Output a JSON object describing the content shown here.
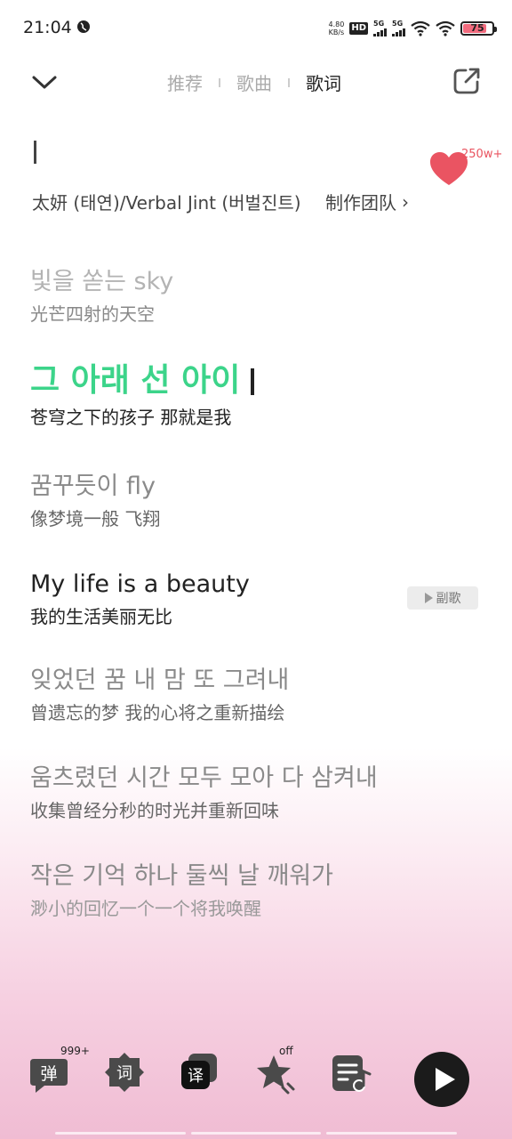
{
  "status_bar": {
    "time": "21:04",
    "net_speed_value": "4.80",
    "net_speed_unit": "KB/s",
    "hd_label": "HD",
    "hd_sub": "1",
    "hd_sub2": "2",
    "sig1": "5G",
    "sig2": "5G",
    "battery": "75"
  },
  "header": {
    "tabs": [
      {
        "label": "推荐"
      },
      {
        "label": "歌曲"
      },
      {
        "label": "歌词"
      }
    ],
    "active_tab": "歌词"
  },
  "song": {
    "like_count": "250w+",
    "artist": "太妍 (태연)/Verbal Jint (버벌진트)",
    "credits_label": "制作团队"
  },
  "lyrics": [
    {
      "orig": "빛을 쏟는 sky",
      "trans": "光芒四射的天空"
    },
    {
      "orig": "그 아래 선 아이",
      "trans": "苍穹之下的孩子 那就是我"
    },
    {
      "orig": "꿈꾸듯이 fly",
      "trans": "像梦境一般 飞翔"
    },
    {
      "orig": "My life is a beauty",
      "trans": "我的生活美丽无比"
    },
    {
      "orig": "잊었던 꿈 내 맘 또 그려내",
      "trans": "曾遗忘的梦 我的心将之重新描绘"
    },
    {
      "orig": "움츠렸던 시간 모두 모아 다 삼켜내",
      "trans": "收集曾经分秒的时光并重新回味"
    },
    {
      "orig": "작은 기억 하나 둘씩 날 깨워가",
      "trans": "渺小的回忆一个一个将我唤醒"
    }
  ],
  "chorus_label": "副歌",
  "toolbar": {
    "danmaku_label": "弹",
    "danmaku_badge": "999+",
    "lyric_label": "词",
    "translate_label": "译",
    "star_badge": "off"
  },
  "colors": {
    "accent_green": "#3cd48a",
    "heart_red": "#e9535f",
    "bg_pink": "#f0bcd3"
  }
}
